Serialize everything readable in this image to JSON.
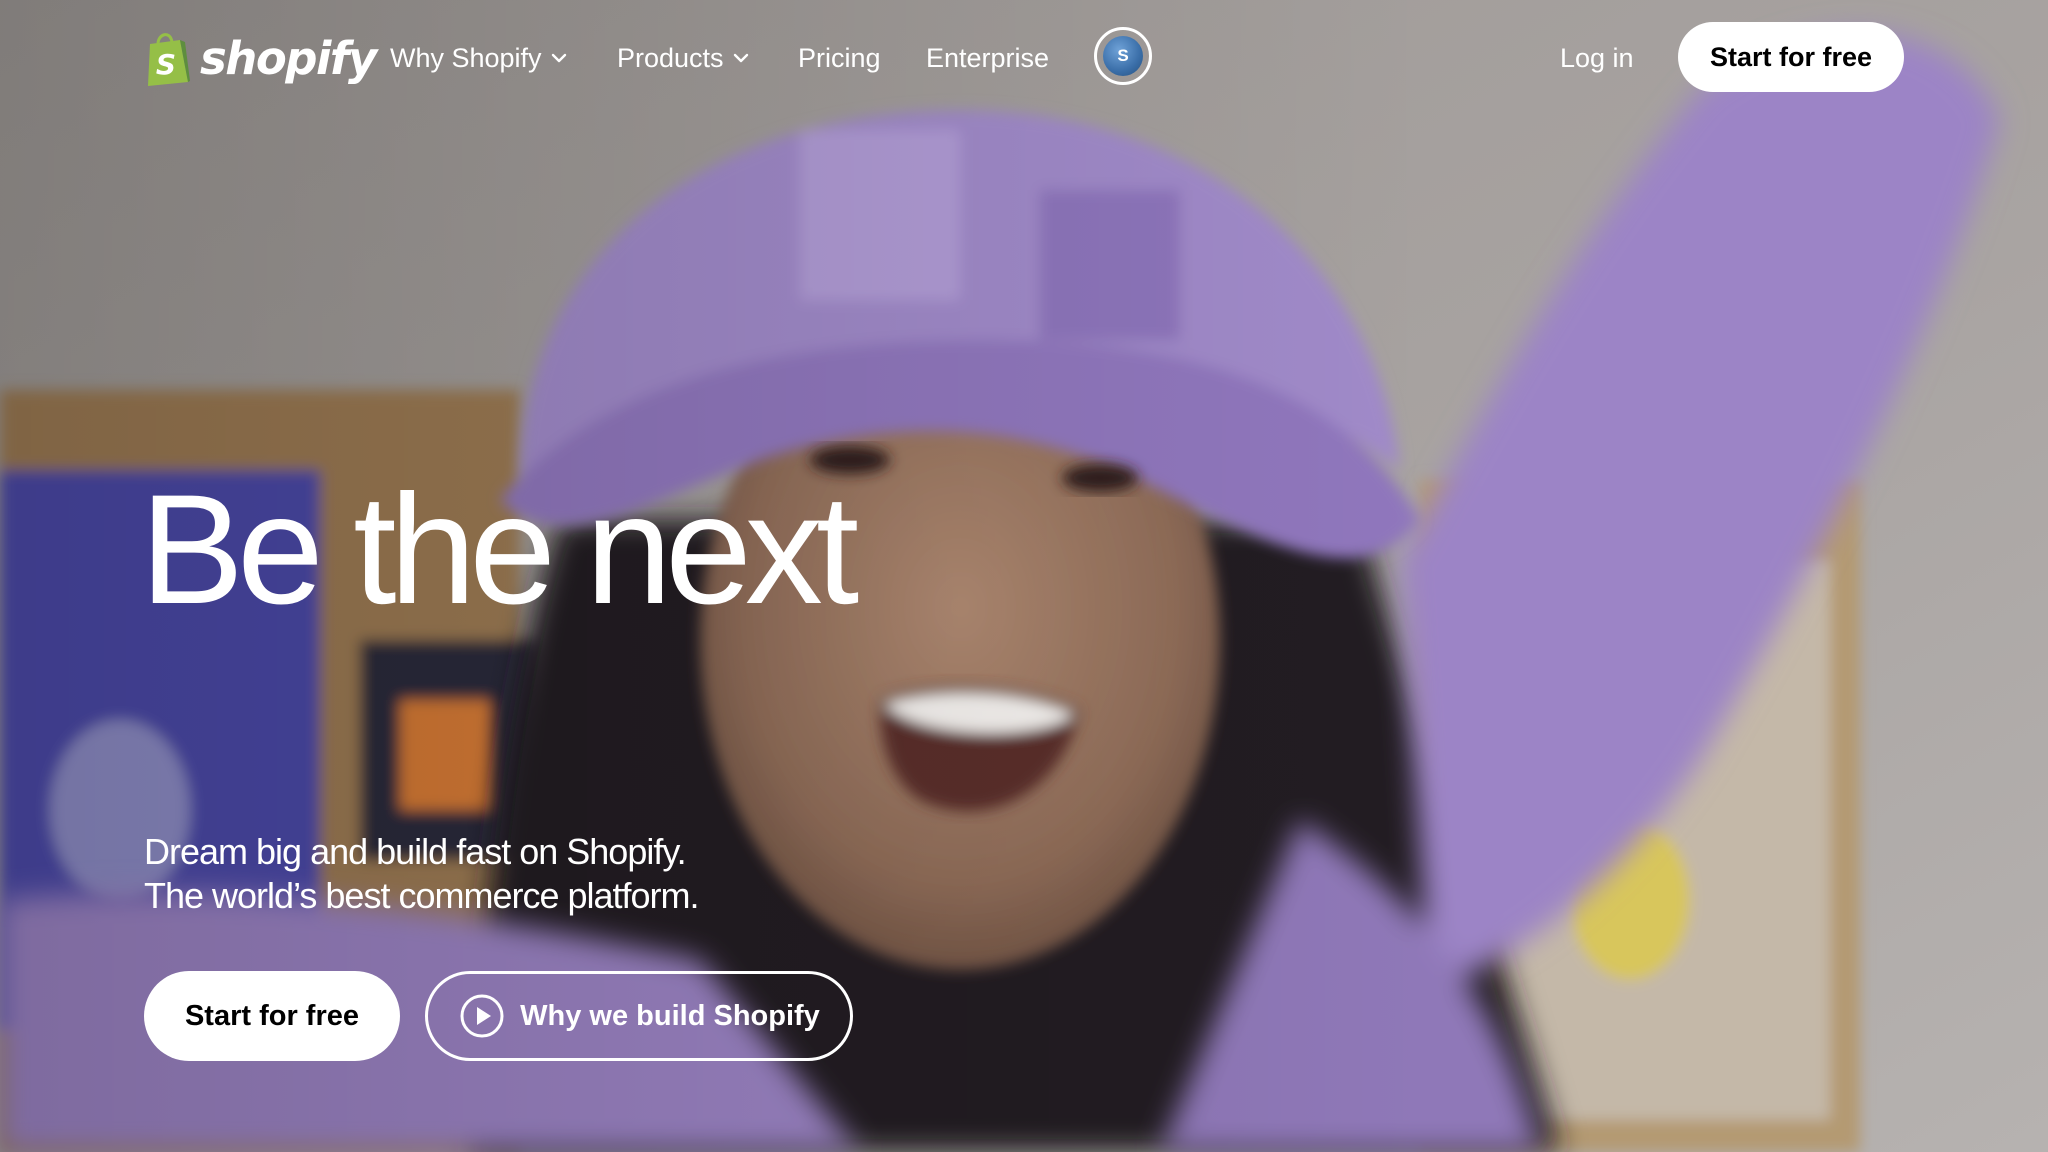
{
  "nav": {
    "logo_text": "shopify",
    "logo_letter": "S",
    "links": [
      {
        "label": "Why Shopify",
        "has_dropdown": true
      },
      {
        "label": "Products",
        "has_dropdown": true
      },
      {
        "label": "Pricing",
        "has_dropdown": false
      },
      {
        "label": "Enterprise",
        "has_dropdown": false
      }
    ],
    "globe_icon": "shop-app-icon",
    "globe_glyph": "S",
    "login_label": "Log in",
    "cta_label": "Start for free"
  },
  "hero": {
    "headline": "Be the next",
    "subline_1": "Dream big and build fast on Shopify.",
    "subline_2": "The world’s best commerce platform.",
    "primary_cta": "Start for free",
    "secondary_cta": "Why we build Shopify",
    "secondary_icon": "play-circle-icon"
  },
  "colors": {
    "brand_green": "#95bf47",
    "brand_green_dark": "#5e8e3e",
    "text_on_image": "#ffffff",
    "button_bg": "#ffffff",
    "button_text": "#000000",
    "hat_purple": "#9d86c8"
  }
}
